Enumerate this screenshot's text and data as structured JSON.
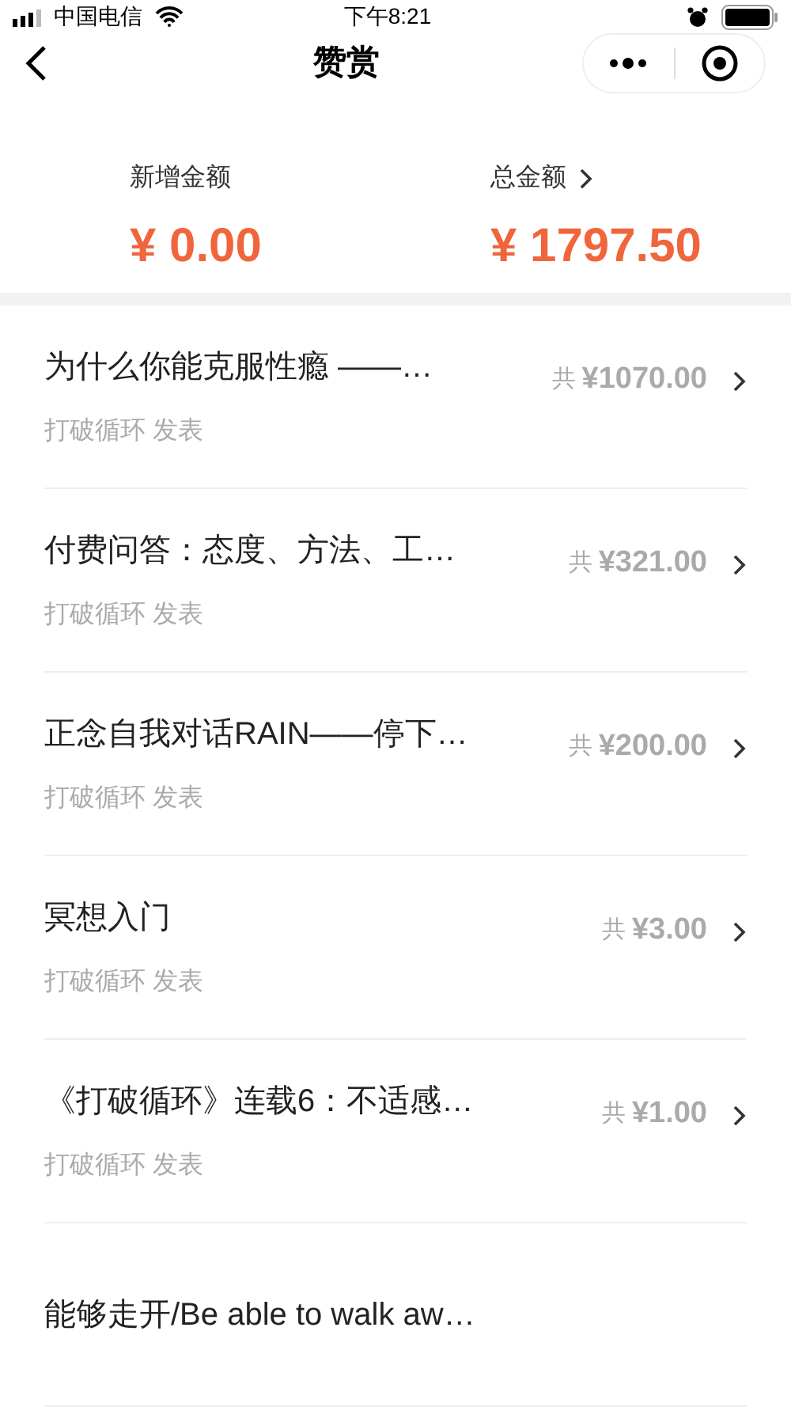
{
  "status_bar": {
    "carrier": "中国电信",
    "time": "下午8:21"
  },
  "nav": {
    "title": "赞赏"
  },
  "summary": [
    {
      "label": "新增金额",
      "value": "¥ 0.00",
      "link": false
    },
    {
      "label": "总金额",
      "value": "¥ 1797.50",
      "link": true
    }
  ],
  "items": [
    {
      "title": "为什么你能克服性瘾 ——…",
      "meta": "打破循环 发表",
      "prefix": "共",
      "amount": "¥1070.00"
    },
    {
      "title": "付费问答：态度、方法、工…",
      "meta": "打破循环 发表",
      "prefix": "共",
      "amount": "¥321.00"
    },
    {
      "title": "正念自我对话RAIN——停下…",
      "meta": "打破循环 发表",
      "prefix": "共",
      "amount": "¥200.00"
    },
    {
      "title": "冥想入门",
      "meta": "打破循环 发表",
      "prefix": "共",
      "amount": "¥3.00"
    },
    {
      "title": "《打破循环》连载6：不适感…",
      "meta": "打破循环 发表",
      "prefix": "共",
      "amount": "¥1.00"
    },
    {
      "title": "能够走开/Be able to walk aw…"
    }
  ]
}
